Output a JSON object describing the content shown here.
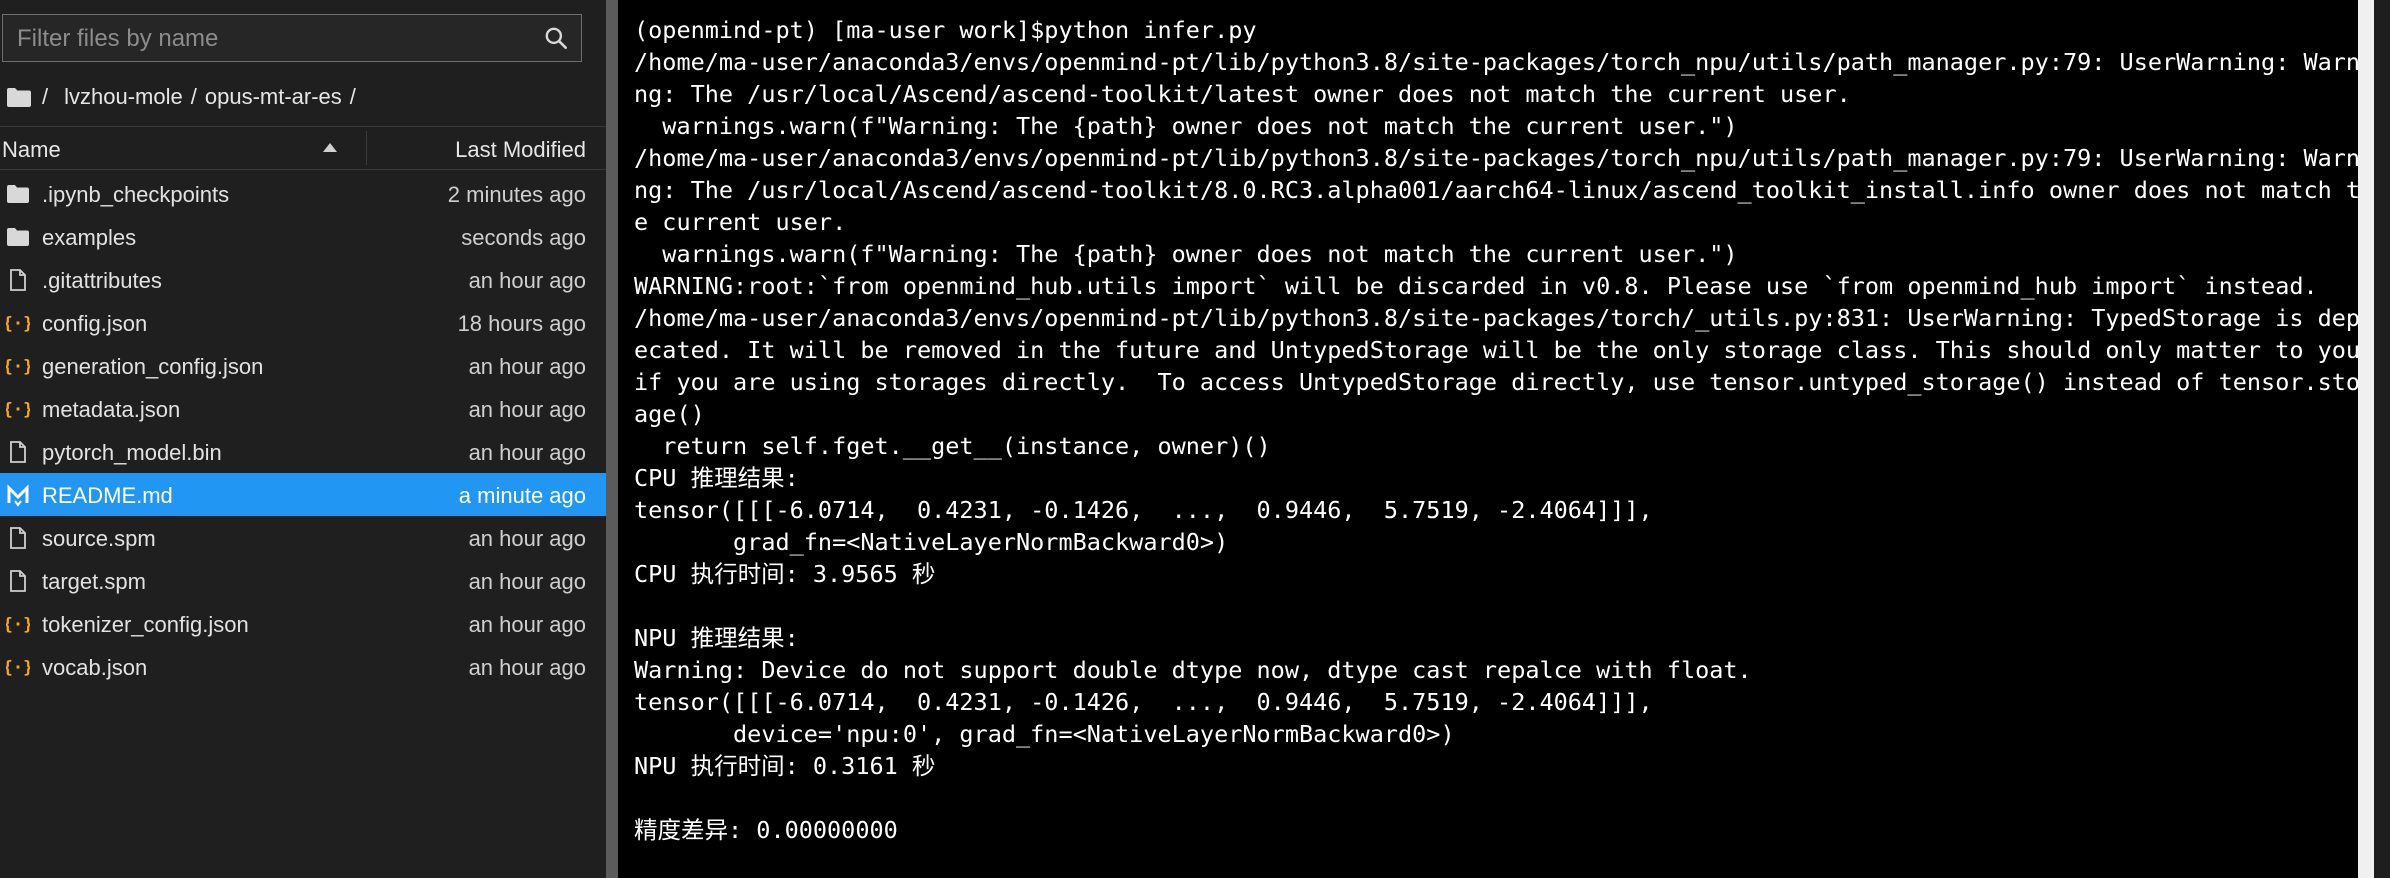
{
  "filebrowser": {
    "filter_placeholder": "Filter files by name",
    "breadcrumb": {
      "root": "/",
      "parts": [
        "lvzhou-mole",
        "opus-mt-ar-es"
      ],
      "trailing": "/"
    },
    "columns": {
      "name": "Name",
      "modified": "Last Modified"
    },
    "files": [
      {
        "name": ".ipynb_checkpoints",
        "modified": "2 minutes ago",
        "icon": "folder-icon",
        "selected": false
      },
      {
        "name": "examples",
        "modified": "seconds ago",
        "icon": "folder-icon",
        "selected": false
      },
      {
        "name": ".gitattributes",
        "modified": "an hour ago",
        "icon": "file-icon",
        "selected": false
      },
      {
        "name": "config.json",
        "modified": "18 hours ago",
        "icon": "json-icon",
        "selected": false
      },
      {
        "name": "generation_config.json",
        "modified": "an hour ago",
        "icon": "json-icon",
        "selected": false
      },
      {
        "name": "metadata.json",
        "modified": "an hour ago",
        "icon": "json-icon",
        "selected": false
      },
      {
        "name": "pytorch_model.bin",
        "modified": "an hour ago",
        "icon": "file-icon",
        "selected": false
      },
      {
        "name": "README.md",
        "modified": "a minute ago",
        "icon": "markdown-icon",
        "selected": true
      },
      {
        "name": "source.spm",
        "modified": "an hour ago",
        "icon": "file-icon",
        "selected": false
      },
      {
        "name": "target.spm",
        "modified": "an hour ago",
        "icon": "file-icon",
        "selected": false
      },
      {
        "name": "tokenizer_config.json",
        "modified": "an hour ago",
        "icon": "json-icon",
        "selected": false
      },
      {
        "name": "vocab.json",
        "modified": "an hour ago",
        "icon": "json-icon",
        "selected": false
      }
    ]
  },
  "terminal": {
    "lines": [
      "(openmind-pt) [ma-user work]$python infer.py",
      "/home/ma-user/anaconda3/envs/openmind-pt/lib/python3.8/site-packages/torch_npu/utils/path_manager.py:79: UserWarning: Warni",
      "ng: The /usr/local/Ascend/ascend-toolkit/latest owner does not match the current user.",
      "  warnings.warn(f\"Warning: The {path} owner does not match the current user.\")",
      "/home/ma-user/anaconda3/envs/openmind-pt/lib/python3.8/site-packages/torch_npu/utils/path_manager.py:79: UserWarning: Warni",
      "ng: The /usr/local/Ascend/ascend-toolkit/8.0.RC3.alpha001/aarch64-linux/ascend_toolkit_install.info owner does not match th",
      "e current user.",
      "  warnings.warn(f\"Warning: The {path} owner does not match the current user.\")",
      "WARNING:root:`from openmind_hub.utils import` will be discarded in v0.8. Please use `from openmind_hub import` instead.",
      "/home/ma-user/anaconda3/envs/openmind-pt/lib/python3.8/site-packages/torch/_utils.py:831: UserWarning: TypedStorage is depr",
      "ecated. It will be removed in the future and UntypedStorage will be the only storage class. This should only matter to you",
      "if you are using storages directly.  To access UntypedStorage directly, use tensor.untyped_storage() instead of tensor.stor",
      "age()",
      "  return self.fget.__get__(instance, owner)()",
      "CPU 推理结果:",
      "tensor([[[-6.0714,  0.4231, -0.1426,  ...,  0.9446,  5.7519, -2.4064]]],",
      "       grad_fn=<NativeLayerNormBackward0>)",
      "CPU 执行时间: 3.9565 秒",
      "",
      "NPU 推理结果:",
      "Warning: Device do not support double dtype now, dtype cast repalce with float.",
      "tensor([[[-6.0714,  0.4231, -0.1426,  ...,  0.9446,  5.7519, -2.4064]]],",
      "       device='npu:0', grad_fn=<NativeLayerNormBackward0>)",
      "NPU 执行时间: 0.3161 秒",
      "",
      "精度差异: 0.00000000"
    ]
  },
  "colors": {
    "selected_row": "#2196f3",
    "folder": "#d8d8d8",
    "json_icon": "#f5a623",
    "markdown_icon": "#4a9fff",
    "terminal_bg": "#000000",
    "terminal_fg": "#ffffff"
  }
}
